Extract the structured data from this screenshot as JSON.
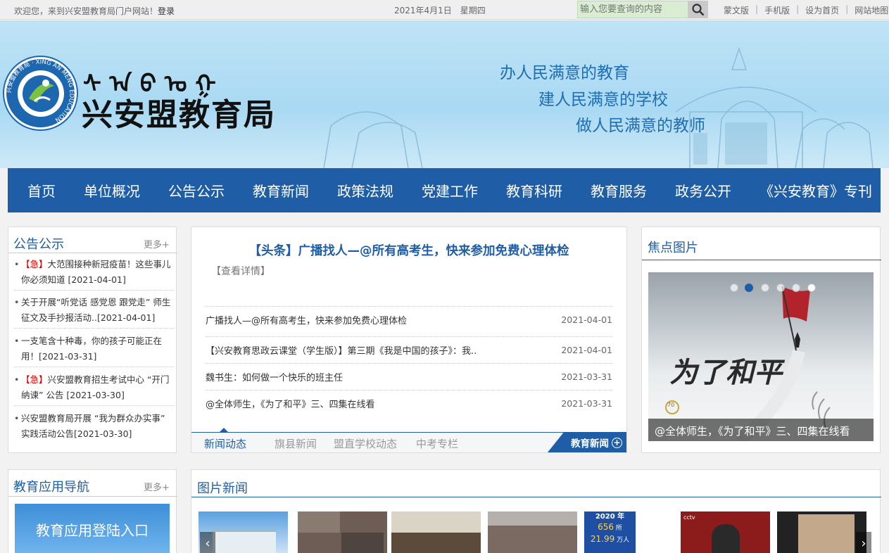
{
  "topbar": {
    "welcome": "欢迎您，来到兴安盟教育局门户网站！",
    "login": "登录",
    "date": "2021年4月1日　星期四",
    "search_placeholder": "输入您要查询的内容",
    "links": [
      "蒙文版",
      "手机版",
      "设为首页",
      "网站地图"
    ]
  },
  "banner": {
    "site_title": "兴安盟教育局",
    "logo_ring_text": "兴安盟教育局 · XING AN MENG EDUCATION",
    "slogans": [
      "办人民满意的教育",
      "建人民满意的学校",
      "做人民满意的教师"
    ]
  },
  "nav": [
    "首页",
    "单位概况",
    "公告公示",
    "教育新闻",
    "政策法规",
    "党建工作",
    "教育科研",
    "教育服务",
    "政务公开",
    "《兴安教育》专刊"
  ],
  "notices": {
    "title": "公告公示",
    "more": "更多+",
    "items": [
      {
        "tag": "【急】",
        "text": "大范围接种新冠疫苗！这些事儿你必须知道 [2021-04-01]"
      },
      {
        "tag": "",
        "text": "关于开展“听党话 感党恩 跟党走” 师生征文及手抄报活动..[2021-04-01]"
      },
      {
        "tag": "",
        "text": "一支笔含十种毒，你的孩子可能正在用！[2021-03-31]"
      },
      {
        "tag": "【急】",
        "text": "兴安盟教育招生考试中心 “开门纳谏” 公告 [2021-03-30]"
      },
      {
        "tag": "",
        "text": "兴安盟教育局开展 “我为群众办实事” 实践活动公告[2021-03-30]"
      }
    ]
  },
  "news": {
    "headline": "【头条】广播找人—@所有高考生，快来参加免费心理体检",
    "detail": "【查看详情】",
    "items": [
      {
        "title": "广播找人—@所有高考生，快来参加免费心理体检",
        "date": "2021-04-01"
      },
      {
        "title": "【兴安教育思政云课堂（学生版）】第三期《我是中国的孩子》：我..",
        "date": "2021-04-01"
      },
      {
        "title": "魏书生：如何做一个快乐的班主任",
        "date": "2021-03-31"
      },
      {
        "title": "@全体师生，《为了和平》三、四集在线看",
        "date": "2021-03-31"
      }
    ],
    "tabs": [
      "新闻动态",
      "旗县新闻",
      "盟直学校动态",
      "中考专栏"
    ],
    "more": "教育新闻"
  },
  "focus": {
    "title": "焦点图片",
    "caption": "@全体师生，《为了和平》三、四集在线看",
    "image_text": "为了和平",
    "badge": "70"
  },
  "apps": {
    "title": "教育应用导航",
    "more": "更多+",
    "banner_label": "教育应用登陆入口"
  },
  "photo_news": {
    "title": "图片新闻",
    "thumb2_title": "2020 年",
    "thumb2_value": "656",
    "thumb2_unit": "所",
    "thumb2_value2": "21.99",
    "thumb2_unit2": "万人",
    "cctv": "cctv"
  },
  "colors": {
    "brand": "#1f5ea6",
    "urgent": "#d40000",
    "banner": "#a9d9f3"
  }
}
